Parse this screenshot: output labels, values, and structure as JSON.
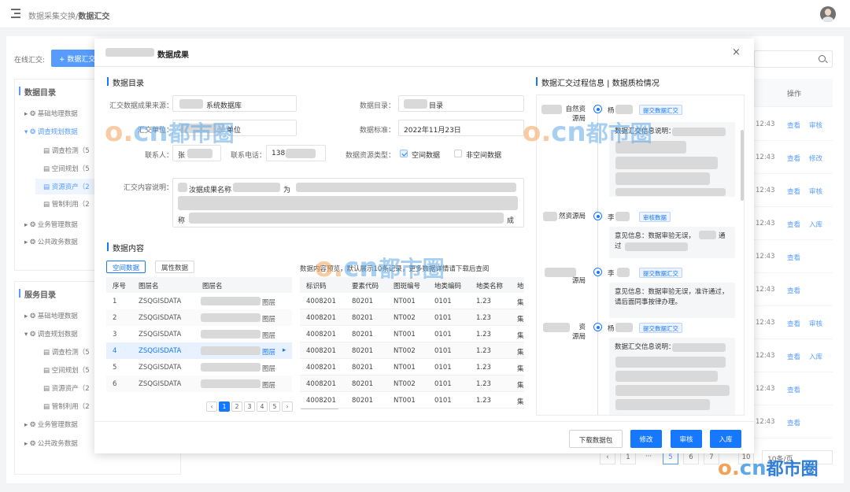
{
  "topbar": {
    "crumb_prefix": "数据采集交换/",
    "crumb_current": "数据汇交"
  },
  "background": {
    "online_label": "在线汇交:",
    "add_button": "+ 数据汇交",
    "catalog_tree": {
      "title": "数据目录",
      "items": [
        "基础地理数据",
        "调查规划数据",
        "调查检测（5",
        "空间规划（5",
        "资源资产（2",
        "管制利用（2",
        "业务管理数据",
        "公共政务数据"
      ]
    },
    "service_tree": {
      "title": "服务目录",
      "items": [
        "基础地理数据",
        "调查规划数据",
        "调查检测（5",
        "空间规划（5",
        "资源资产（2",
        "管制利用（2",
        "业务管理数据",
        "公共政务数据"
      ]
    },
    "op_header": "操作",
    "rows": [
      {
        "time": "12:43",
        "a1": "查看",
        "a2": "审核"
      },
      {
        "time": "12:43",
        "a1": "查看",
        "a2": "修改"
      },
      {
        "time": "12:43",
        "a1": "查看",
        "a2": "审核"
      },
      {
        "time": "12:43",
        "a1": "查看",
        "a2": "入库"
      },
      {
        "time": "12:43",
        "a1": "查看",
        "a2": ""
      },
      {
        "time": "12:43",
        "a1": "查看",
        "a2": ""
      },
      {
        "time": "12:43",
        "a1": "查看",
        "a2": "审核"
      },
      {
        "time": "12:43",
        "a1": "查看",
        "a2": "入库"
      },
      {
        "time": "12:43",
        "a1": "查看",
        "a2": ""
      },
      {
        "time": "12:43",
        "a1": "查看",
        "a2": ""
      }
    ],
    "pager": {
      "prev": "‹",
      "first": "1",
      "dots": "···",
      "p5": "5",
      "p6": "6",
      "p7": "7",
      "p10": "10",
      "next": "›",
      "size": "10条/页"
    }
  },
  "modal": {
    "title": "数据成果",
    "close": "×",
    "catalog_section": "数据目录",
    "source_label": "汇交数据成果来源：",
    "source_value": "系统数据库",
    "dir_label": "数据目录：",
    "dir_value": "目录",
    "unit_label": "汇交单位：",
    "unit_value": "单位",
    "std_label": "数据标准：",
    "std_value": "2022年11月23日",
    "contact_label": "联系人：",
    "contact_value": "张",
    "phone_label": "联系电话：",
    "phone_value": "138",
    "type_label": "数据资源类型：",
    "type_spatial": "空间数据",
    "type_nonspatial": "非空间数据",
    "desc_label": "汇交内容说明：",
    "desc_line1": "汝据成果名称",
    "desc_line1b": "为",
    "desc_line3": "称",
    "desc_line3b": "成",
    "content_section": "数据内容",
    "tab_spatial": "空间数据",
    "tab_attr": "属性数据",
    "layer_headers": [
      "序号",
      "图层名",
      "图层名"
    ],
    "layers": [
      {
        "n": "1",
        "code": "ZSQGISDATA",
        "name": "图层"
      },
      {
        "n": "2",
        "code": "ZSQGISDATA",
        "name": "图层"
      },
      {
        "n": "3",
        "code": "ZSQGISDATA",
        "name": "图层"
      },
      {
        "n": "4",
        "code": "ZSQGISDATA",
        "name": "图层"
      },
      {
        "n": "5",
        "code": "ZSQGISDATA",
        "name": "图层"
      },
      {
        "n": "6",
        "code": "ZSQGISDATA",
        "name": "图层"
      }
    ],
    "layer_pager": {
      "prev": "‹",
      "p1": "1",
      "p2": "2",
      "p3": "3",
      "p4": "4",
      "p5": "5",
      "next": "›"
    },
    "preview_note": "数据内容预览，默认展示10条记录，更多数据详情请下载后查阅",
    "preview_headers": [
      "标识码",
      "要素代码",
      "图斑编号",
      "地类编码",
      "地类名称",
      "地"
    ],
    "preview_rows": [
      [
        "4008201",
        "80201",
        "NT001",
        "0101",
        "1.23",
        "集"
      ],
      [
        "4008201",
        "80201",
        "NT002",
        "0101",
        "1.23",
        "集"
      ],
      [
        "4008201",
        "80201",
        "NT001",
        "0101",
        "1.23",
        "集"
      ],
      [
        "4008201",
        "80201",
        "NT002",
        "0101",
        "1.23",
        "集"
      ],
      [
        "4008201",
        "80201",
        "NT001",
        "0101",
        "1.23",
        "集"
      ],
      [
        "4008201",
        "80201",
        "NT002",
        "0101",
        "1.23",
        "集"
      ],
      [
        "4008201",
        "80201",
        "NT001",
        "0101",
        "1.23",
        "集"
      ]
    ],
    "process_section": "数据汇交过程信息 | 数据质检情况",
    "timeline": [
      {
        "org": "自然资\n源局",
        "name": "杨",
        "tag": "提交数据汇交",
        "card_title": "数据汇交信息说明："
      },
      {
        "org": "然资源局",
        "name": "李",
        "tag": "审核数据",
        "card_text": "意见信息：数据审验无误，",
        "card_text2": "通",
        "card_text3": "过"
      },
      {
        "org": "源局",
        "name": "李",
        "tag": "提交数据汇交",
        "card_text": "意见信息：数据审验无误，准许通过，请后面同事按律办理。"
      },
      {
        "org": "资\n源局",
        "name": "杨",
        "tag": "提交数据汇交",
        "card_title": "数据汇交信息说明："
      }
    ],
    "buttons": {
      "download": "下载数据包",
      "modify": "修改",
      "review": "审核",
      "store": "入库"
    }
  },
  "watermark": {
    "o": "o.",
    "cn": "cn",
    "brand": "都市圈"
  }
}
